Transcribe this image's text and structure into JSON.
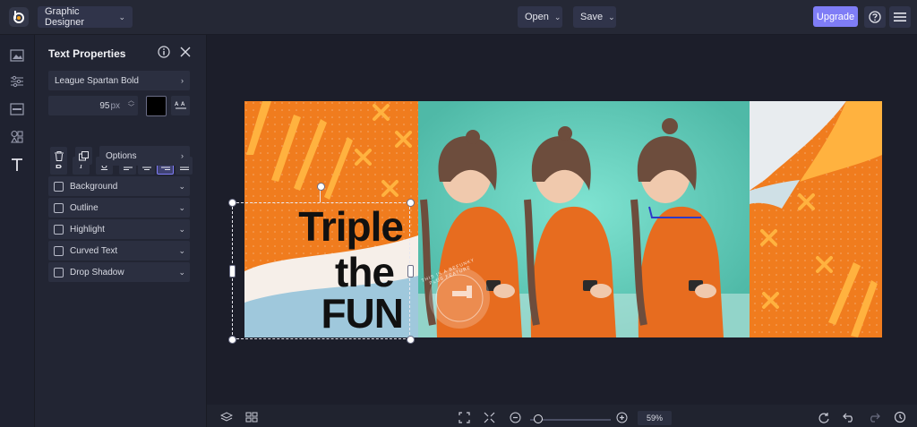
{
  "header": {
    "app_name": "Graphic Designer",
    "open_label": "Open",
    "save_label": "Save",
    "upgrade_label": "Upgrade"
  },
  "panel": {
    "title": "Text Properties",
    "font_name": "League Spartan Bold",
    "font_size": "95",
    "font_unit": "px",
    "options_label": "Options",
    "sections": [
      "Background",
      "Outline",
      "Highlight",
      "Curved Text",
      "Drop Shadow"
    ]
  },
  "canvas": {
    "text_lines": [
      "Triple",
      "the",
      "FUN"
    ],
    "badge_text": "THIS IS A BEFUNKY PLUS FEATURE"
  },
  "bottom": {
    "zoom_value": "59",
    "zoom_unit": "%",
    "zoom_slider_level": 0.05
  },
  "colors": {
    "accent": "#7f7df6",
    "orange": "#f07c1e",
    "teal": "#5ecab8",
    "text_color_swatch": "#000000"
  }
}
